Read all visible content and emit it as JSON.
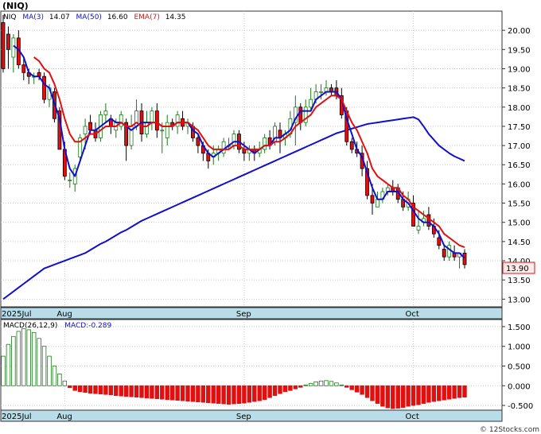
{
  "symbol_label": "(NIQ)",
  "legend": {
    "ticker": "NIQ",
    "ma3_label": "MA(3)",
    "ma3_value": "14.07",
    "ma50_label": "MA(50)",
    "ma50_value": "16.60",
    "ema7_label": "EMA(7)",
    "ema7_value": "14.35"
  },
  "last_price_label": "13.90",
  "macd_legend": {
    "label": "MACD(26,12,9)",
    "value_label": "MACD:-0.289"
  },
  "watermark": "© 12Stocks.com",
  "colors": {
    "up": "#1a7a1a",
    "down": "#e01010",
    "ma3": "#1010cc",
    "ma50": "#1010cc",
    "ema7": "#e01010",
    "axis_band": "#b8dde8",
    "macd_up": "#1a7a1a",
    "macd_down": "#e01010"
  },
  "chart_data": [
    {
      "type": "candlestick",
      "title": "(NIQ)",
      "ylim": [
        12.8,
        20.5
      ],
      "y_ticks": [
        "20.00",
        "19.50",
        "19.00",
        "18.50",
        "18.00",
        "17.50",
        "17.00",
        "16.50",
        "16.00",
        "15.50",
        "15.00",
        "14.50",
        "14.00",
        "13.50",
        "13.00"
      ],
      "x_ticks": [
        "2025Jul",
        "Aug",
        "Sep",
        "Oct"
      ],
      "x_tick_index": [
        0,
        12,
        47,
        80
      ],
      "candles": [
        [
          20.2,
          19.0,
          20.4,
          18.9
        ],
        [
          19.9,
          19.5,
          20.1,
          19.0
        ],
        [
          19.3,
          19.8,
          19.9,
          18.9
        ],
        [
          19.8,
          19.1,
          20.0,
          19.0
        ],
        [
          19.1,
          18.9,
          19.3,
          18.7
        ],
        [
          18.9,
          18.8,
          19.0,
          18.6
        ],
        [
          18.8,
          18.8,
          18.9,
          18.6
        ],
        [
          18.9,
          18.8,
          19.0,
          18.7
        ],
        [
          18.8,
          18.2,
          18.9,
          18.1
        ],
        [
          18.2,
          18.5,
          18.6,
          18.0
        ],
        [
          18.4,
          17.7,
          18.5,
          17.6
        ],
        [
          17.9,
          16.9,
          18.0,
          16.9
        ],
        [
          16.9,
          16.2,
          17.1,
          16.1
        ],
        [
          16.1,
          16.1,
          16.3,
          15.9
        ],
        [
          16.0,
          16.4,
          16.5,
          15.8
        ],
        [
          16.7,
          17.2,
          17.3,
          16.6
        ],
        [
          17.3,
          17.5,
          17.7,
          16.9
        ],
        [
          17.6,
          17.4,
          17.8,
          17.3
        ],
        [
          17.4,
          17.2,
          17.6,
          17.1
        ],
        [
          17.2,
          17.8,
          17.9,
          17.1
        ],
        [
          17.8,
          17.9,
          18.1,
          17.6
        ],
        [
          17.7,
          17.5,
          17.8,
          17.3
        ],
        [
          17.4,
          17.6,
          17.7,
          17.2
        ],
        [
          17.5,
          17.8,
          17.9,
          17.4
        ],
        [
          17.6,
          17.0,
          17.7,
          16.6
        ],
        [
          17.0,
          17.5,
          17.8,
          16.9
        ],
        [
          17.5,
          17.9,
          18.2,
          17.4
        ],
        [
          17.9,
          17.3,
          18.1,
          17.1
        ],
        [
          17.3,
          17.6,
          17.9,
          17.2
        ],
        [
          17.6,
          17.9,
          18.0,
          17.4
        ],
        [
          17.9,
          17.4,
          18.1,
          17.2
        ],
        [
          17.4,
          17.4,
          17.6,
          16.8
        ],
        [
          17.2,
          17.6,
          17.8,
          17.0
        ],
        [
          17.6,
          17.5,
          17.7,
          17.4
        ],
        [
          17.5,
          17.8,
          17.9,
          17.3
        ],
        [
          17.7,
          17.5,
          17.9,
          17.4
        ],
        [
          17.5,
          17.6,
          17.7,
          17.3
        ],
        [
          17.5,
          17.2,
          17.6,
          17.1
        ],
        [
          17.2,
          17.0,
          17.3,
          16.8
        ],
        [
          17.0,
          16.8,
          17.1,
          16.6
        ],
        [
          16.8,
          16.6,
          16.9,
          16.4
        ],
        [
          16.7,
          16.8,
          17.0,
          16.5
        ],
        [
          16.8,
          16.9,
          17.0,
          16.6
        ],
        [
          16.8,
          17.1,
          17.2,
          16.7
        ],
        [
          17.0,
          17.0,
          17.2,
          16.9
        ],
        [
          17.0,
          17.3,
          17.4,
          16.9
        ],
        [
          17.3,
          16.9,
          17.4,
          16.8
        ],
        [
          16.9,
          16.8,
          17.1,
          16.6
        ],
        [
          16.8,
          16.9,
          17.0,
          16.6
        ],
        [
          16.9,
          16.8,
          17.0,
          16.6
        ],
        [
          16.8,
          16.9,
          17.1,
          16.7
        ],
        [
          16.9,
          17.2,
          17.3,
          16.8
        ],
        [
          17.2,
          17.0,
          17.4,
          16.9
        ],
        [
          17.1,
          17.5,
          17.6,
          17.0
        ],
        [
          17.4,
          17.2,
          17.6,
          16.8
        ],
        [
          17.2,
          17.3,
          17.4,
          17.0
        ],
        [
          17.3,
          17.7,
          17.9,
          17.2
        ],
        [
          17.6,
          18.0,
          18.3,
          17.0
        ],
        [
          18.0,
          17.6,
          18.1,
          17.4
        ],
        [
          17.6,
          18.0,
          18.2,
          17.5
        ],
        [
          18.0,
          18.2,
          18.5,
          17.9
        ],
        [
          18.2,
          18.4,
          18.6,
          18.1
        ],
        [
          18.4,
          18.4,
          18.6,
          18.2
        ],
        [
          18.4,
          18.5,
          18.7,
          18.3
        ],
        [
          18.5,
          18.4,
          18.6,
          18.3
        ],
        [
          18.5,
          18.3,
          18.7,
          18.2
        ],
        [
          18.3,
          17.8,
          18.5,
          17.7
        ],
        [
          17.9,
          17.1,
          18.0,
          17.0
        ],
        [
          17.1,
          16.9,
          17.2,
          16.8
        ],
        [
          16.9,
          16.8,
          17.1,
          16.7
        ],
        [
          16.8,
          16.4,
          17.0,
          16.2
        ],
        [
          16.4,
          15.7,
          16.6,
          15.6
        ],
        [
          15.7,
          15.5,
          16.0,
          15.2
        ],
        [
          15.4,
          15.6,
          15.8,
          15.4
        ],
        [
          15.6,
          15.8,
          15.9,
          15.5
        ],
        [
          15.8,
          15.9,
          16.0,
          15.7
        ],
        [
          15.9,
          15.8,
          16.1,
          15.7
        ],
        [
          15.9,
          15.6,
          16.0,
          15.5
        ],
        [
          15.6,
          15.4,
          15.8,
          15.3
        ],
        [
          15.4,
          15.6,
          15.8,
          15.3
        ],
        [
          15.5,
          14.9,
          15.7,
          14.9
        ],
        [
          14.8,
          14.9,
          15.3,
          14.7
        ],
        [
          15.0,
          15.1,
          15.3,
          14.9
        ],
        [
          15.2,
          14.9,
          15.4,
          14.8
        ],
        [
          14.9,
          14.7,
          15.1,
          14.6
        ],
        [
          14.6,
          14.4,
          14.8,
          14.3
        ],
        [
          14.3,
          14.1,
          14.4,
          14.0
        ],
        [
          14.1,
          14.4,
          14.5,
          14.0
        ],
        [
          14.2,
          14.1,
          14.4,
          14.0
        ],
        [
          14.1,
          14.2,
          14.2,
          13.8
        ],
        [
          14.2,
          13.9,
          14.3,
          13.8
        ]
      ],
      "ma3": [
        null,
        null,
        19.6,
        19.5,
        19.3,
        18.9,
        18.8,
        18.8,
        18.6,
        18.5,
        18.1,
        17.7,
        16.9,
        16.4,
        16.2,
        16.6,
        17.0,
        17.4,
        17.4,
        17.5,
        17.6,
        17.7,
        17.6,
        17.6,
        17.5,
        17.4,
        17.5,
        17.6,
        17.6,
        17.6,
        17.6,
        17.5,
        17.5,
        17.5,
        17.6,
        17.6,
        17.6,
        17.4,
        17.3,
        17.0,
        16.8,
        16.7,
        16.8,
        16.9,
        17.0,
        17.1,
        17.1,
        17.0,
        16.9,
        16.8,
        16.9,
        17.0,
        17.0,
        17.2,
        17.2,
        17.3,
        17.4,
        17.7,
        17.9,
        17.9,
        17.9,
        18.2,
        18.3,
        18.4,
        18.4,
        18.4,
        18.2,
        17.7,
        17.3,
        16.9,
        16.7,
        16.3,
        15.9,
        15.6,
        15.6,
        15.8,
        15.8,
        15.8,
        15.6,
        15.5,
        15.3,
        15.1,
        15.0,
        15.0,
        14.9,
        14.7,
        14.4,
        14.3,
        14.2,
        14.2,
        14.07
      ],
      "ma50": [
        13.0,
        13.1,
        13.2,
        13.3,
        13.4,
        13.5,
        13.6,
        13.7,
        13.8,
        13.85,
        13.9,
        13.95,
        14.0,
        14.05,
        14.1,
        14.15,
        14.2,
        14.28,
        14.36,
        14.44,
        14.5,
        14.58,
        14.66,
        14.74,
        14.8,
        14.88,
        14.96,
        15.04,
        15.1,
        15.16,
        15.22,
        15.28,
        15.34,
        15.4,
        15.46,
        15.52,
        15.58,
        15.64,
        15.7,
        15.76,
        15.82,
        15.88,
        15.94,
        16.0,
        16.06,
        16.12,
        16.18,
        16.24,
        16.3,
        16.36,
        16.42,
        16.48,
        16.54,
        16.6,
        16.66,
        16.72,
        16.78,
        16.84,
        16.9,
        16.96,
        17.02,
        17.08,
        17.14,
        17.2,
        17.26,
        17.32,
        17.36,
        17.4,
        17.44,
        17.48,
        17.52,
        17.56,
        17.58,
        17.6,
        17.62,
        17.64,
        17.66,
        17.68,
        17.7,
        17.72,
        17.74,
        17.68,
        17.5,
        17.3,
        17.15,
        17.0,
        16.9,
        16.8,
        16.72,
        16.66,
        16.6
      ],
      "ema7": [
        null,
        null,
        null,
        null,
        null,
        null,
        19.3,
        19.2,
        19.0,
        18.9,
        18.6,
        18.2,
        17.7,
        17.3,
        17.1,
        17.1,
        17.2,
        17.3,
        17.3,
        17.4,
        17.5,
        17.5,
        17.5,
        17.6,
        17.5,
        17.5,
        17.6,
        17.5,
        17.5,
        17.6,
        17.6,
        17.5,
        17.5,
        17.5,
        17.6,
        17.6,
        17.6,
        17.5,
        17.4,
        17.2,
        17.0,
        16.9,
        16.9,
        16.9,
        16.9,
        17.0,
        17.0,
        16.9,
        16.9,
        16.9,
        16.9,
        17.0,
        17.0,
        17.1,
        17.1,
        17.2,
        17.3,
        17.5,
        17.6,
        17.7,
        17.8,
        18.0,
        18.1,
        18.2,
        18.3,
        18.3,
        18.2,
        17.9,
        17.6,
        17.4,
        17.1,
        16.8,
        16.4,
        16.2,
        16.1,
        16.0,
        15.9,
        15.9,
        15.7,
        15.6,
        15.4,
        15.3,
        15.2,
        15.1,
        15.0,
        14.9,
        14.7,
        14.6,
        14.5,
        14.4,
        14.35
      ]
    },
    {
      "type": "bar",
      "title": "MACD(26,12,9)",
      "ylim": [
        -0.62,
        1.68
      ],
      "y_ticks": [
        "1.500",
        "1.000",
        "0.500",
        "0.000",
        "-0.500"
      ],
      "x_ticks": [
        "2025Jul",
        "Aug",
        "Sep",
        "Oct"
      ],
      "values": [
        0.75,
        1.05,
        1.25,
        1.38,
        1.45,
        1.42,
        1.35,
        1.2,
        1.0,
        0.75,
        0.5,
        0.3,
        0.12,
        -0.05,
        -0.12,
        -0.15,
        -0.17,
        -0.19,
        -0.2,
        -0.21,
        -0.22,
        -0.23,
        -0.25,
        -0.26,
        -0.27,
        -0.28,
        -0.29,
        -0.3,
        -0.31,
        -0.32,
        -0.33,
        -0.34,
        -0.35,
        -0.36,
        -0.37,
        -0.38,
        -0.39,
        -0.4,
        -0.41,
        -0.42,
        -0.43,
        -0.44,
        -0.45,
        -0.46,
        -0.47,
        -0.46,
        -0.45,
        -0.44,
        -0.42,
        -0.4,
        -0.38,
        -0.35,
        -0.3,
        -0.25,
        -0.2,
        -0.15,
        -0.12,
        -0.08,
        -0.04,
        0.02,
        0.06,
        0.1,
        0.12,
        0.13,
        0.11,
        0.07,
        0.02,
        -0.04,
        -0.1,
        -0.16,
        -0.22,
        -0.3,
        -0.38,
        -0.45,
        -0.52,
        -0.56,
        -0.58,
        -0.57,
        -0.55,
        -0.52,
        -0.5,
        -0.48,
        -0.45,
        -0.42,
        -0.4,
        -0.38,
        -0.36,
        -0.34,
        -0.32,
        -0.3,
        -0.289
      ]
    }
  ]
}
